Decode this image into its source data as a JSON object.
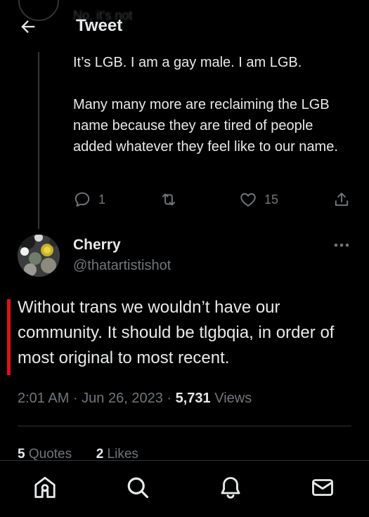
{
  "header": {
    "title": "Tweet",
    "ghost_text": "No, it's not"
  },
  "previous_tweet": {
    "paragraphs": [
      "It’s LGB. I am a gay male. I am LGB.",
      "Many many more are reclaiming the LGB name because they are tired of people added whatever they feel like to our name."
    ],
    "actions": {
      "reply_count": "1",
      "like_count": "15"
    }
  },
  "tweet": {
    "author_name": "Cherry",
    "author_handle": "@thatartistishot",
    "text": "Without trans we wouldn’t have our community. It should be tlgbqia, in order of most original to most recent.",
    "time": "2:01 AM",
    "date": "Jun 26, 2023",
    "views_count": "5,731",
    "views_label": "Views",
    "quotes_count": "5",
    "quotes_label": "Quotes",
    "likes_count": "2",
    "likes_label": "Likes"
  },
  "icons": {
    "back": "arrow-left-icon",
    "reply": "reply-icon",
    "retweet": "retweet-icon",
    "like": "heart-icon",
    "share": "share-icon",
    "more": "more-horizontal-icon",
    "nav": [
      "home-icon",
      "search-icon",
      "bell-icon",
      "mail-icon"
    ]
  },
  "colors": {
    "background": "#000000",
    "text": "#e7e9ea",
    "muted": "#71767b",
    "annotation": "#e0101a"
  }
}
